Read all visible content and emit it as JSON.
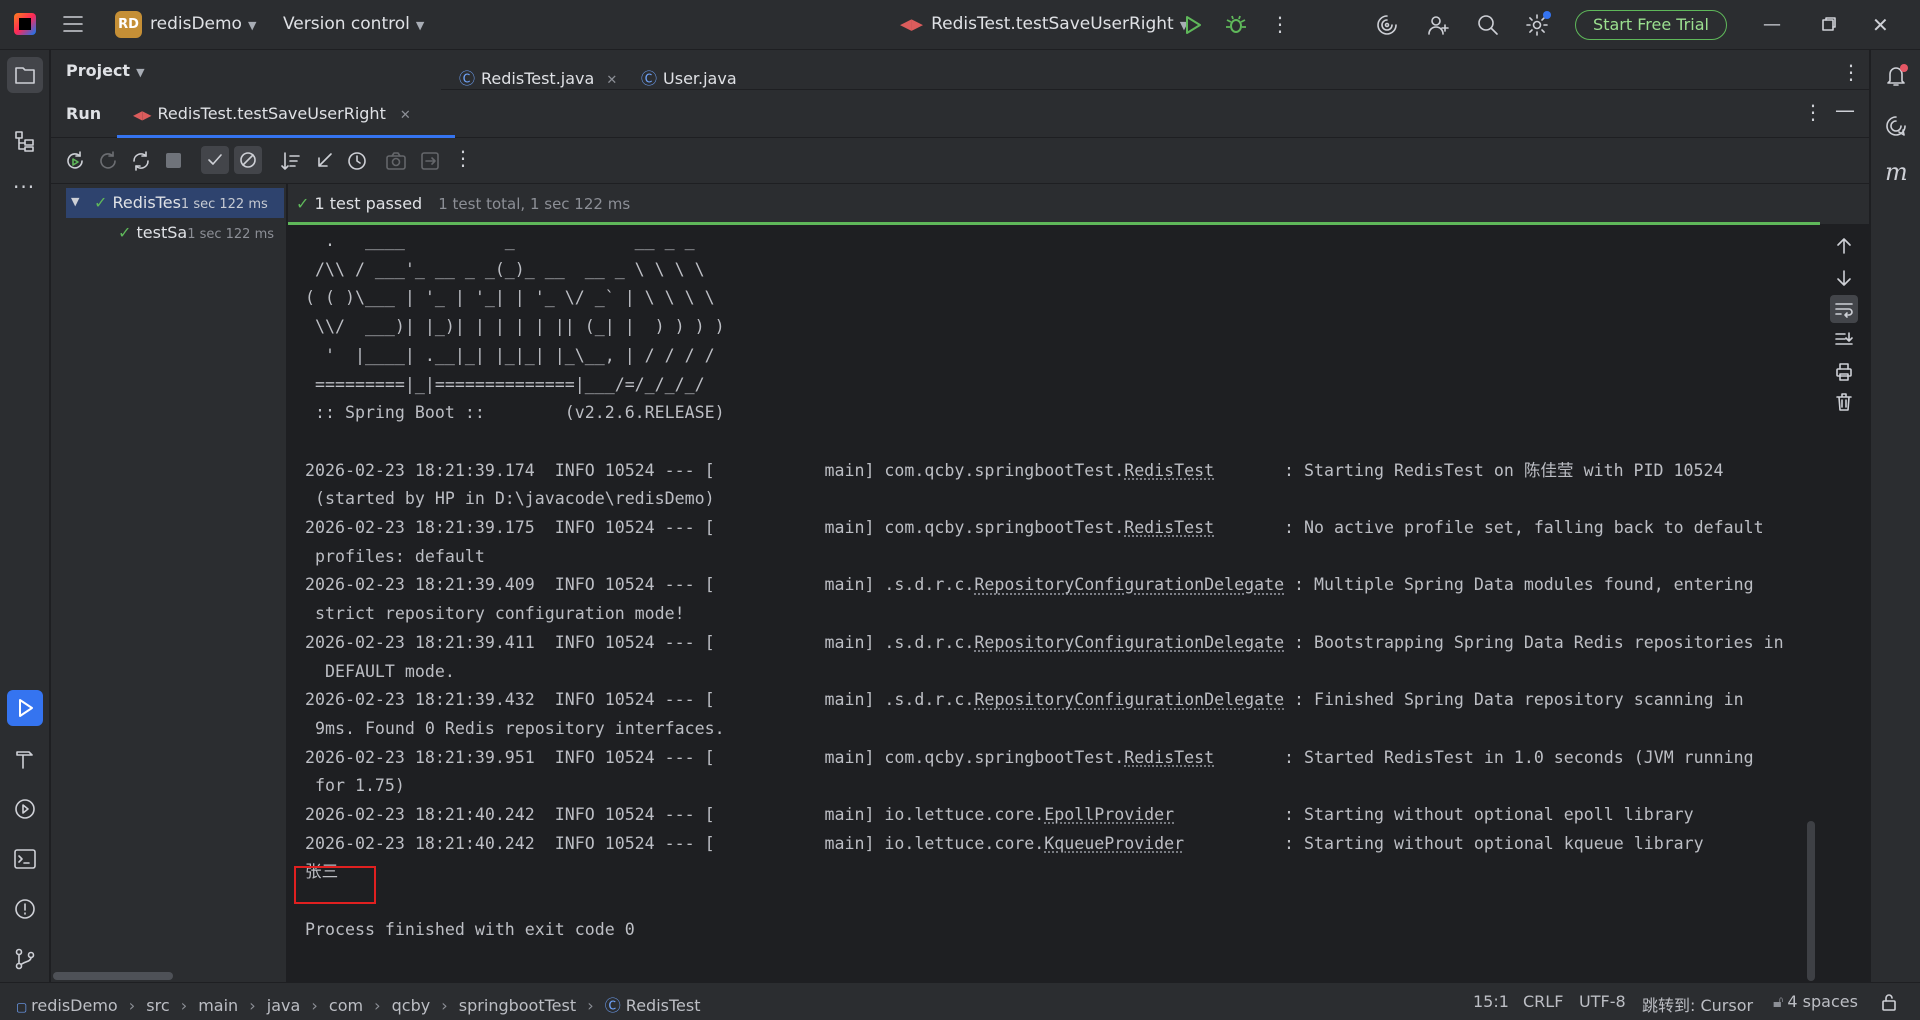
{
  "titlebar": {
    "project_badge": "RD",
    "project_name": "redisDemo",
    "vcs_label": "Version control",
    "run_config": "RedisTest.testSaveUserRight",
    "trial_button": "Start Free Trial"
  },
  "project_panel": {
    "title": "Project"
  },
  "editor_tabs": [
    {
      "label": "RedisTest.java"
    },
    {
      "label": "User.java"
    }
  ],
  "run_window": {
    "title": "Run",
    "tab_label": "RedisTest.testSaveUserRight"
  },
  "test_tree": [
    {
      "label": "RedisTes",
      "time": "1 sec 122 ms"
    },
    {
      "label": "testSa",
      "time": "1 sec 122 ms"
    }
  ],
  "test_status": {
    "passed": "1 test passed",
    "summary": "1 test total, 1 sec 122 ms"
  },
  "console": {
    "banner": [
      "  .   ____          _            __ _ _",
      " /\\\\ / ___'_ __ _ _(_)_ __  __ _ \\ \\ \\ \\",
      "( ( )\\___ | '_ | '_| | '_ \\/ _` | \\ \\ \\ \\",
      " \\\\/  ___)| |_)| | | | | || (_| |  ) ) ) )",
      "  '  |____| .__|_| |_|_| |_\\__, | / / / /",
      " =========|_|==============|___/=/_/_/_/",
      " :: Spring Boot ::        (v2.2.6.RELEASE)"
    ],
    "log_lines": [
      {
        "prefix": "2026-02-23 18:21:39.174  INFO 10524 --- [           main] com.qcby.springbootTest.",
        "cls": "RedisTest",
        "pad": "       ",
        "msg": ": Starting RedisTest on 陈佳莹 with PID 10524",
        "cont": " (started by HP in D:\\javacode\\redisDemo)"
      },
      {
        "prefix": "2026-02-23 18:21:39.175  INFO 10524 --- [           main] com.qcby.springbootTest.",
        "cls": "RedisTest",
        "pad": "       ",
        "msg": ": No active profile set, falling back to default",
        "cont": " profiles: default"
      },
      {
        "prefix": "2026-02-23 18:21:39.409  INFO 10524 --- [           main] .s.d.r.c.",
        "cls": "RepositoryConfigurationDelegate",
        "pad": " ",
        "msg": ": Multiple Spring Data modules found, entering",
        "cont": " strict repository configuration mode!"
      },
      {
        "prefix": "2026-02-23 18:21:39.411  INFO 10524 --- [           main] .s.d.r.c.",
        "cls": "RepositoryConfigurationDelegate",
        "pad": " ",
        "msg": ": Bootstrapping Spring Data Redis repositories in",
        "cont": "  DEFAULT mode."
      },
      {
        "prefix": "2026-02-23 18:21:39.432  INFO 10524 --- [           main] .s.d.r.c.",
        "cls": "RepositoryConfigurationDelegate",
        "pad": " ",
        "msg": ": Finished Spring Data repository scanning in",
        "cont": " 9ms. Found 0 Redis repository interfaces."
      },
      {
        "prefix": "2026-02-23 18:21:39.951  INFO 10524 --- [           main] com.qcby.springbootTest.",
        "cls": "RedisTest",
        "pad": "       ",
        "msg": ": Started RedisTest in 1.0 seconds (JVM running",
        "cont": " for 1.75)"
      },
      {
        "prefix": "2026-02-23 18:21:40.242  INFO 10524 --- [           main] io.lettuce.core.",
        "cls": "EpollProvider",
        "pad": "           ",
        "msg": ": Starting without optional epoll library",
        "cont": ""
      },
      {
        "prefix": "2026-02-23 18:21:40.242  INFO 10524 --- [           main] io.lettuce.core.",
        "cls": "KqueueProvider",
        "pad": "          ",
        "msg": ": Starting without optional kqueue library",
        "cont": ""
      }
    ],
    "output_value": "张三",
    "exit_line": "Process finished with exit code 0"
  },
  "breadcrumb": [
    "redisDemo",
    "src",
    "main",
    "java",
    "com",
    "qcby",
    "springbootTest",
    "RedisTest"
  ],
  "status": {
    "position": "15:1",
    "line_sep": "CRLF",
    "encoding": "UTF-8",
    "goto": "跳转到: Cursor",
    "indent": "4 spaces"
  },
  "colors": {
    "accent": "#3574f0",
    "success": "#5fb85a",
    "highlight_box": "#e02020"
  }
}
